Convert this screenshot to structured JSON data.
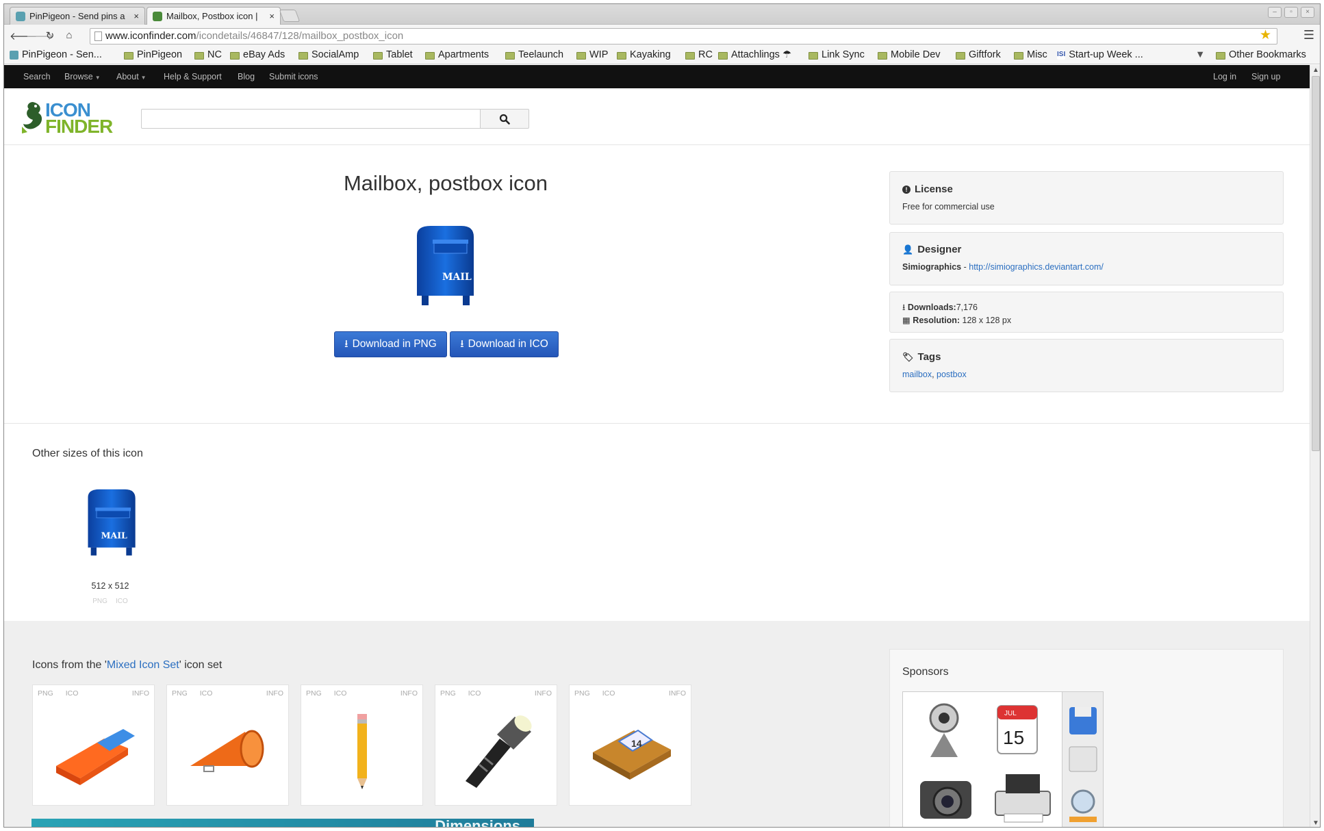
{
  "browser": {
    "tabs": [
      {
        "title": "PinPigeon - Send pins a",
        "close": "×"
      },
      {
        "title": "Mailbox, Postbox icon |",
        "close": "×"
      }
    ],
    "url_host": "www.iconfinder.com",
    "url_path": "/icondetails/46847/128/mailbox_postbox_icon",
    "bookmarks": [
      "PinPigeon - Sen...",
      "PinPigeon",
      "NC",
      "eBay Ads",
      "SocialAmp",
      "Tablet",
      "Apartments",
      "Teelaunch",
      "WIP",
      "Kayaking",
      "RC",
      "Attachlings ☂",
      "Link Sync",
      "Mobile Dev",
      "Giftfork",
      "Misc",
      "Start-up Week ..."
    ],
    "bookmarks_overflow": "▼",
    "other_bookmarks": "Other Bookmarks"
  },
  "topnav": {
    "search": "Search",
    "browse": "Browse",
    "about": "About",
    "help": "Help & Support",
    "blog": "Blog",
    "submit": "Submit icons",
    "login": "Log in",
    "signup": "Sign up"
  },
  "logo": {
    "line1": "ICON",
    "line2": "FINDER"
  },
  "search": {
    "placeholder": "",
    "value": ""
  },
  "icon": {
    "title": "Mailbox, postbox icon",
    "mail_label": "MAIL",
    "download_png": "Download in PNG",
    "download_ico": "Download in ICO"
  },
  "license": {
    "heading": "License",
    "text": "Free for commercial use"
  },
  "designer": {
    "heading": "Designer",
    "name": "Simiographics",
    "separator": " - ",
    "url": "http://simiographics.deviantart.com/"
  },
  "stats": {
    "downloads_label": "Downloads:",
    "downloads_value": "7,176",
    "resolution_label": "Resolution:",
    "resolution_value": "128 x 128 px"
  },
  "tags": {
    "heading": "Tags",
    "items": [
      "mailbox",
      "postbox"
    ],
    "separator": ", "
  },
  "other_sizes": {
    "title": "Other sizes of this icon",
    "size": "512 x 512",
    "png": "PNG",
    "ico": "ICO"
  },
  "iconset": {
    "prefix": "Icons from the '",
    "name": "Mixed Icon Set",
    "suffix": "' icon set",
    "cards": [
      {
        "png": "PNG",
        "ico": "ICO",
        "info": "INFO",
        "icon": "eraser-icon"
      },
      {
        "png": "PNG",
        "ico": "ICO",
        "info": "INFO",
        "icon": "megaphone-icon"
      },
      {
        "png": "PNG",
        "ico": "ICO",
        "info": "INFO",
        "icon": "pencil-icon"
      },
      {
        "png": "PNG",
        "ico": "ICO",
        "info": "INFO",
        "icon": "flashlight-icon"
      },
      {
        "png": "PNG",
        "ico": "ICO",
        "info": "INFO",
        "icon": "calendar-book-icon"
      }
    ],
    "banner_text": "Dimensions"
  },
  "sponsors": {
    "title": "Sponsors",
    "calendar_month": "JUL",
    "calendar_day": "15"
  },
  "colors": {
    "accent_blue": "#2a6ec0",
    "button_blue": "#2456b8",
    "topbar": "#111111",
    "logo_blue": "#3a8fd0",
    "logo_green": "#7fb42a"
  }
}
